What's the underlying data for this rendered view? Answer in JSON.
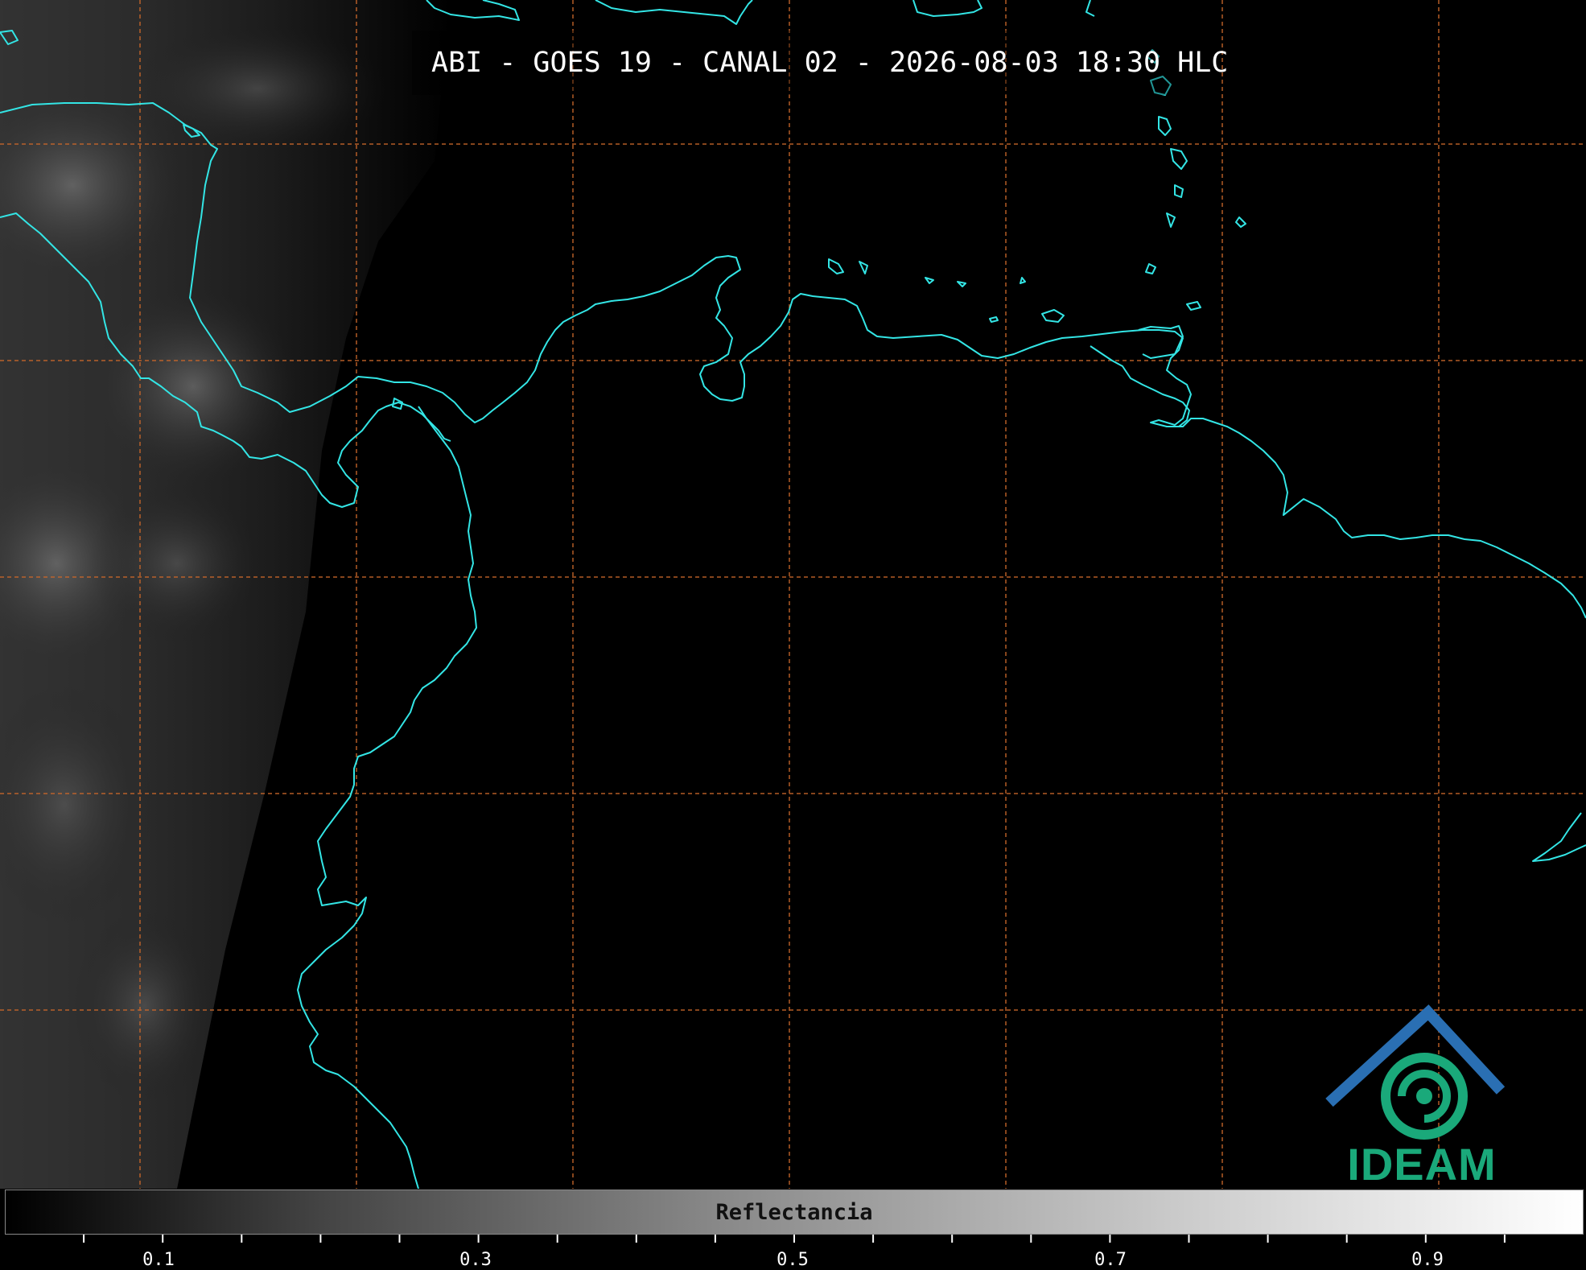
{
  "title": "ABI - GOES 19 - CANAL 02 - 2026-08-03 18:30 HLC",
  "colorbar": {
    "label": "Reflectancia",
    "tick_labels": [
      "0.1",
      "0.3",
      "0.5",
      "0.7",
      "0.9"
    ]
  },
  "logo": {
    "text": "IDEAM"
  },
  "colors": {
    "coastline": "#33e5e5",
    "gridline": "#c8662a",
    "background": "#000000",
    "logo_teal": "#1aa97a",
    "logo_blue": "#2a6fb3"
  }
}
